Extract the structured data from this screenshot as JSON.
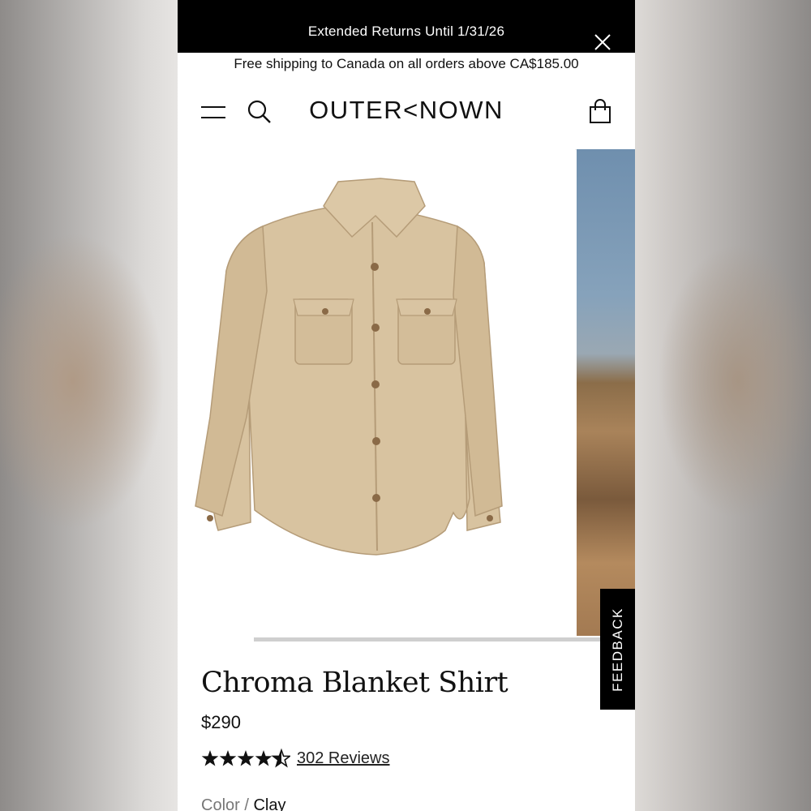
{
  "promo": {
    "text": "Extended Returns Until 1/31/26"
  },
  "shipping": {
    "text": "Free shipping to Canada on all orders above CA$185.00"
  },
  "header": {
    "logo": "OUTER<NOWN",
    "icons": [
      "menu-icon",
      "search-icon",
      "bag-icon"
    ]
  },
  "feedback": {
    "label": "FEEDBACK"
  },
  "product": {
    "title": "Chroma Blanket Shirt",
    "price": "$290",
    "rating": 4.5,
    "rating_max": 5,
    "reviews": "302 Reviews",
    "color_label": "Color /",
    "color_value": "Clay"
  },
  "colors": {
    "accent": "#000000",
    "shirt": "#d8c3a0",
    "background": "#ffffff"
  }
}
